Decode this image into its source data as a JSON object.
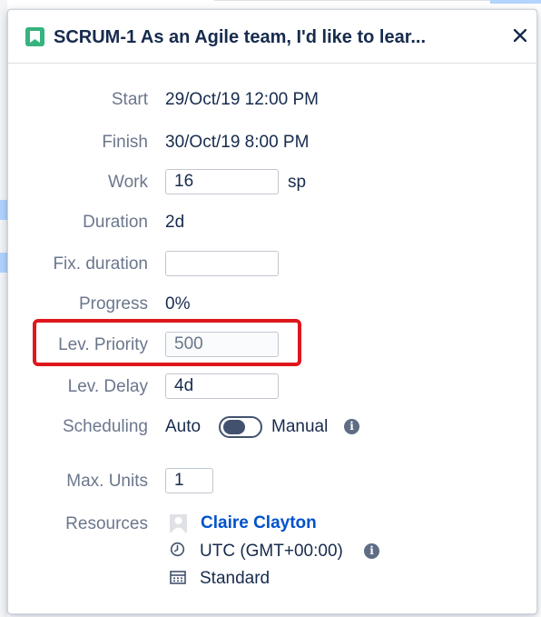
{
  "popup": {
    "title": "SCRUM-1 As an Agile team, I'd like to lear...",
    "close_icon": "close-icon",
    "issue_type_icon": "story-bookmark-icon"
  },
  "fields": {
    "start": {
      "label": "Start",
      "value": "29/Oct/19 12:00 PM"
    },
    "finish": {
      "label": "Finish",
      "value": "30/Oct/19 8:00 PM"
    },
    "work": {
      "label": "Work",
      "value": "16",
      "unit": "sp"
    },
    "duration": {
      "label": "Duration",
      "value": "2d"
    },
    "fix_duration": {
      "label": "Fix. duration",
      "value": ""
    },
    "progress": {
      "label": "Progress",
      "value": "0%"
    },
    "lev_priority": {
      "label": "Lev. Priority",
      "value": "500"
    },
    "lev_delay": {
      "label": "Lev. Delay",
      "value": "4d"
    },
    "scheduling": {
      "label": "Scheduling",
      "auto": "Auto",
      "manual": "Manual",
      "toggle_state": "auto"
    },
    "max_units": {
      "label": "Max. Units",
      "value": "1"
    },
    "resources": {
      "label": "Resources",
      "name": "Claire Clayton",
      "timezone": "UTC (GMT+00:00)",
      "calendar": "Standard"
    }
  },
  "colors": {
    "accent": "#0052cc",
    "issue_icon": "#36b37e",
    "highlight": "#e0161d"
  }
}
